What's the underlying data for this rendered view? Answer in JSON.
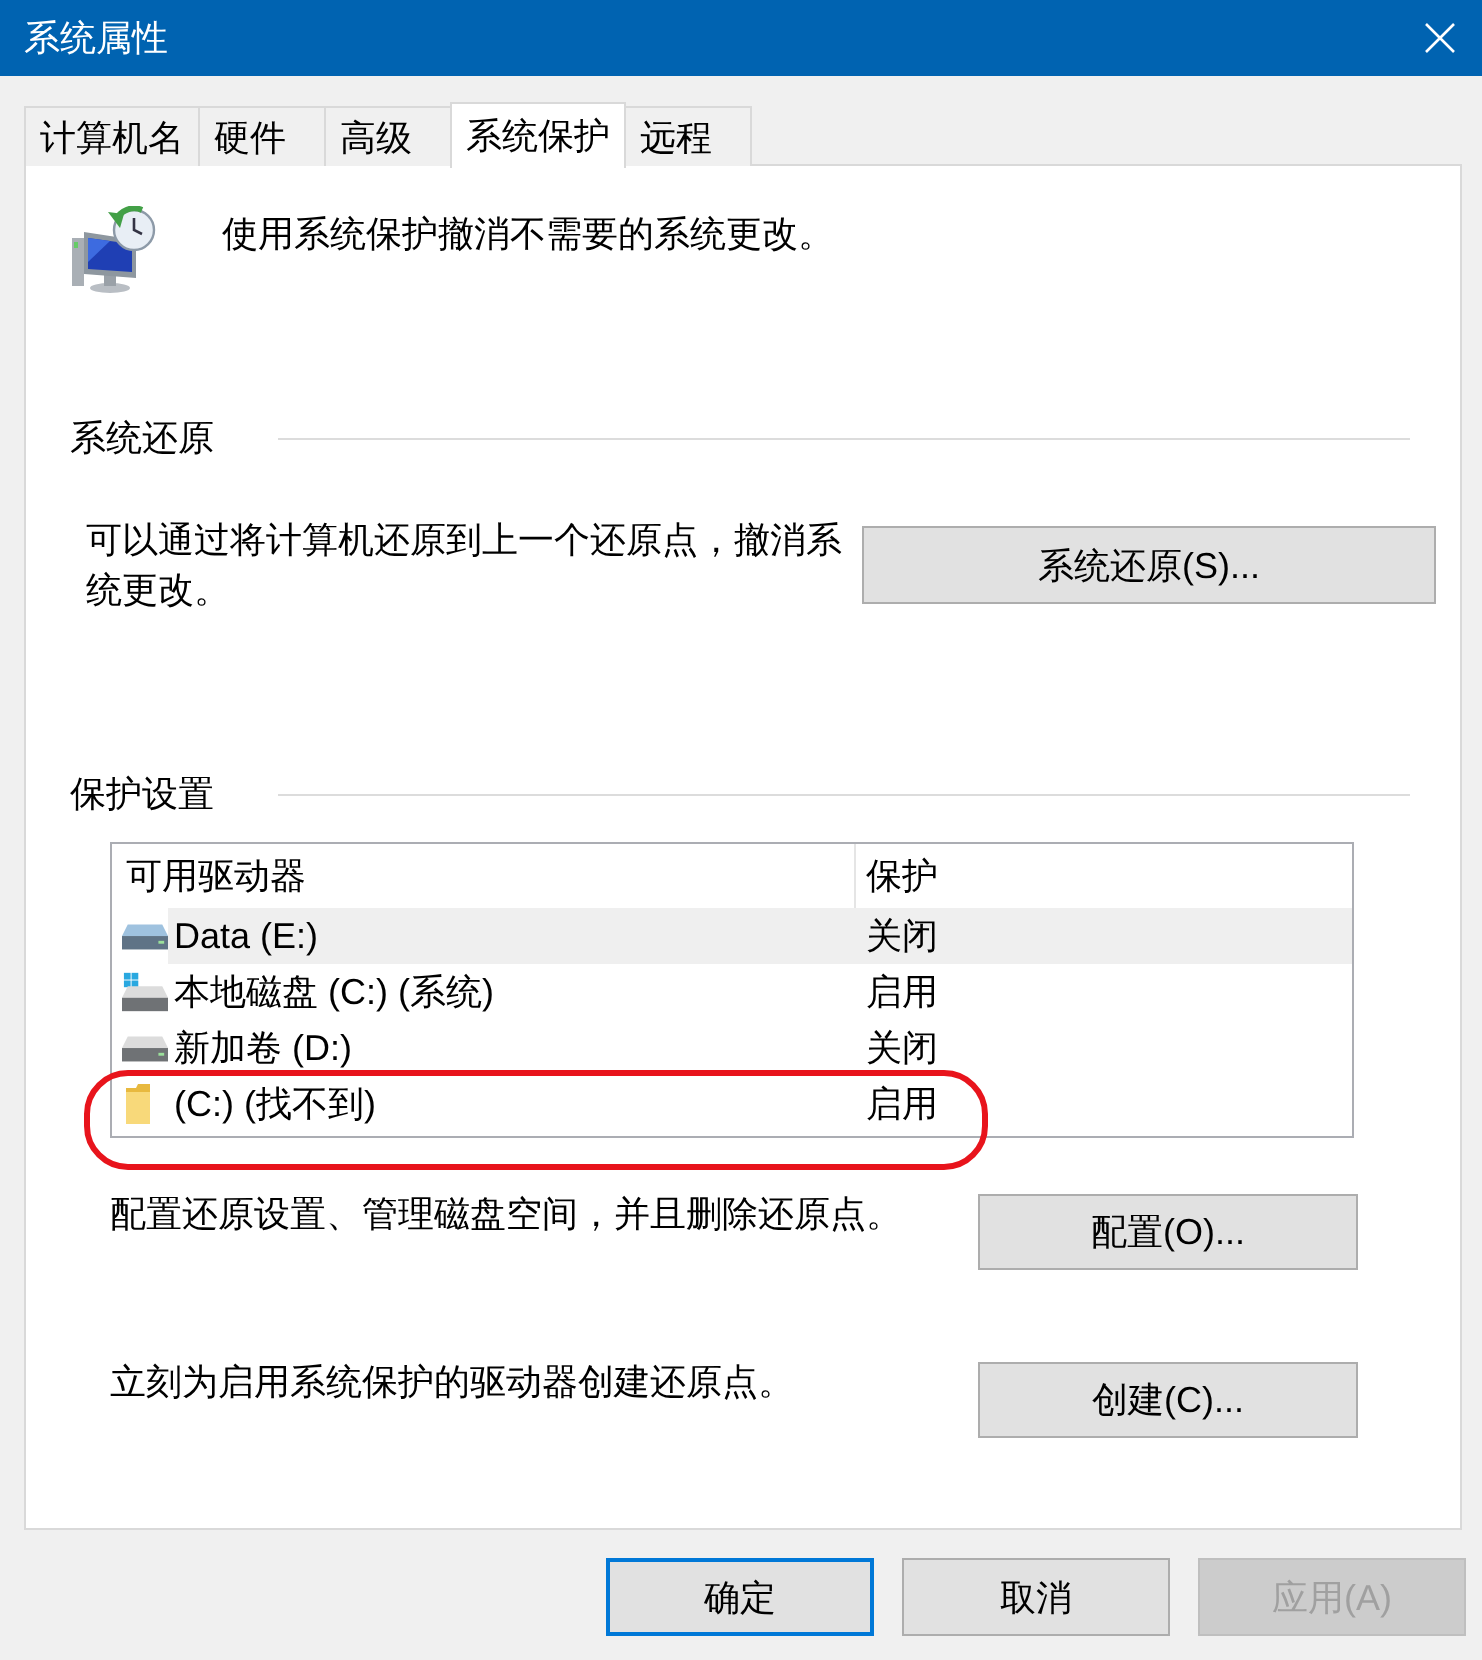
{
  "window": {
    "title": "系统属性"
  },
  "tabs": [
    {
      "label": "计算机名",
      "selected": false
    },
    {
      "label": "硬件",
      "selected": false
    },
    {
      "label": "高级",
      "selected": false
    },
    {
      "label": "系统保护",
      "selected": true
    },
    {
      "label": "远程",
      "selected": false
    }
  ],
  "header": {
    "description": "使用系统保护撤消不需要的系统更改。"
  },
  "restore_section": {
    "heading": "系统还原",
    "description": "可以通过将计算机还原到上一个还原点，撤消系统更改。",
    "button": "系统还原(S)..."
  },
  "protection_section": {
    "heading": "保护设置",
    "columns": [
      "可用驱动器",
      "保护"
    ],
    "rows": [
      {
        "kind": "external-drive",
        "name": "Data (E:)",
        "protection": "关闭",
        "selected": true,
        "circled": false
      },
      {
        "kind": "system-drive",
        "name": "本地磁盘 (C:) (系统)",
        "protection": "启用",
        "selected": false,
        "circled": false
      },
      {
        "kind": "drive",
        "name": "新加卷 (D:)",
        "protection": "关闭",
        "selected": false,
        "circled": false
      },
      {
        "kind": "folder",
        "name": "(C:) (找不到)",
        "protection": "启用",
        "selected": false,
        "circled": true
      }
    ],
    "actions": [
      {
        "description": "配置还原设置、管理磁盘空间，并且删除还原点。",
        "button": "配置(O)..."
      },
      {
        "description": "立刻为启用系统保护的驱动器创建还原点。",
        "button": "创建(C)..."
      }
    ]
  },
  "buttons": [
    {
      "label": "确定",
      "default": true,
      "disabled": false
    },
    {
      "label": "取消",
      "default": false,
      "disabled": false
    },
    {
      "label": "应用(A)",
      "default": false,
      "disabled": true
    }
  ]
}
